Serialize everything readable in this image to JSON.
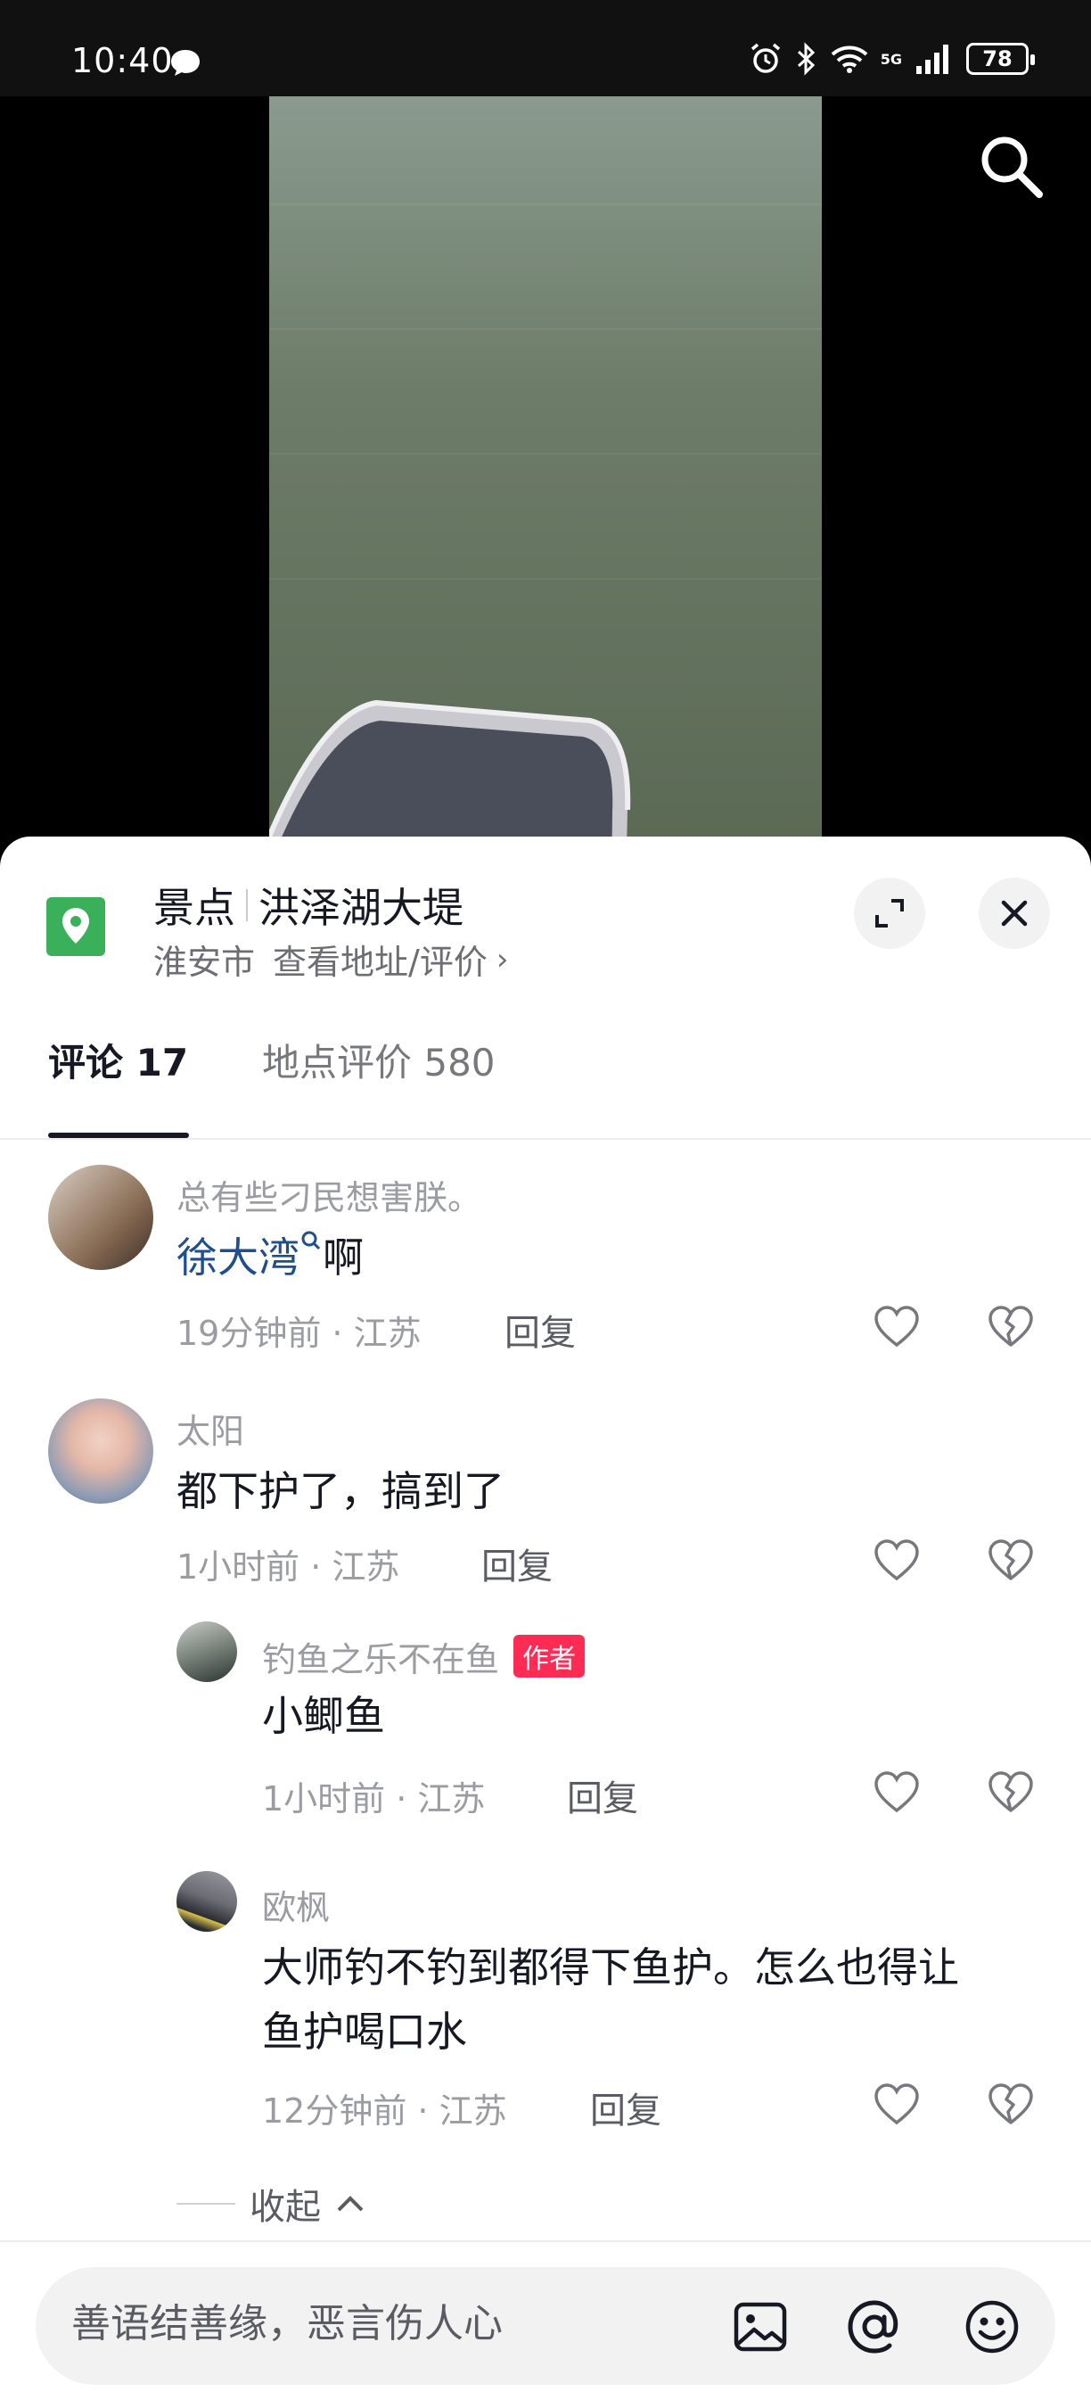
{
  "status_bar": {
    "time": "10:40",
    "signal_label": "5G",
    "battery": "78"
  },
  "location": {
    "category": "景点",
    "name": "洪泽湖大堤",
    "city": "淮安市",
    "link": "查看地址/评价",
    "pin_color": "#3bb05a"
  },
  "tabs": [
    {
      "label": "评论 17",
      "active": true
    },
    {
      "label": "地点评价 580",
      "active": false
    }
  ],
  "comments": [
    {
      "name": "总有些刁民想害朕。",
      "mention": "徐大湾",
      "text": "啊",
      "time": "19分钟前 · 江苏",
      "reply": "回复"
    },
    {
      "name": "太阳",
      "text": "都下护了，搞到了",
      "time": "1小时前 · 江苏",
      "reply": "回复",
      "replies": [
        {
          "name": "钓鱼之乐不在鱼",
          "badge": "作者",
          "text": "小鲫鱼",
          "time": "1小时前 · 江苏",
          "reply": "回复"
        },
        {
          "name": "欧枫",
          "text_line1": "大师钓不钓到都得下鱼护。怎么也得让",
          "text_line2": "鱼护喝口水",
          "time": "12分钟前 · 江苏",
          "reply": "回复"
        }
      ]
    }
  ],
  "collapse_label": "收起",
  "input": {
    "placeholder": "善语结善缘，恶言伤人心"
  },
  "colors": {
    "accent": "#fe2c55",
    "mention": "#1f4e8d",
    "text_primary": "#161823",
    "text_secondary": "#9b9ca1"
  }
}
